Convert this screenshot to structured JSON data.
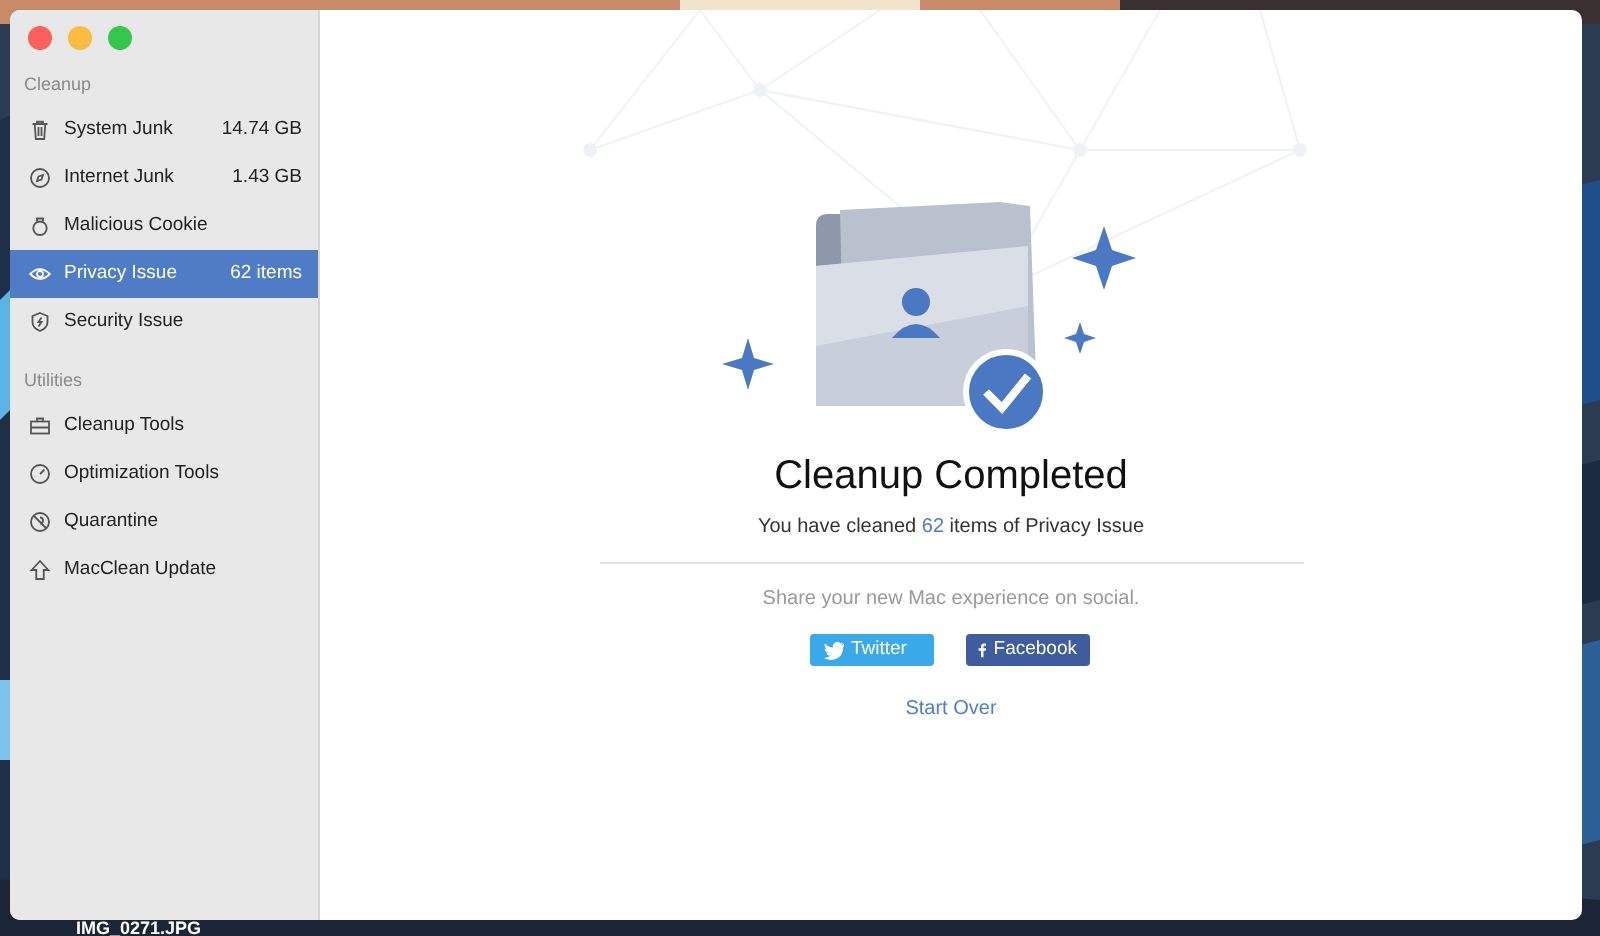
{
  "desktop": {
    "labels": [
      {
        "text": "IMG_0271.JPG"
      }
    ]
  },
  "sidebar": {
    "sections": [
      {
        "heading": "Cleanup",
        "items": [
          {
            "label": "System Junk",
            "value": "14.74 GB",
            "selected": false
          },
          {
            "label": "Internet Junk",
            "value": "1.43 GB",
            "selected": false
          },
          {
            "label": "Malicious Cookie",
            "selected": false
          },
          {
            "label": "Privacy Issue",
            "value": "62 items",
            "selected": true
          },
          {
            "label": "Security Issue",
            "selected": false
          }
        ]
      },
      {
        "heading": "Utilities",
        "items": [
          {
            "label": "Cleanup Tools",
            "selected": false
          },
          {
            "label": "Optimization Tools",
            "selected": false
          },
          {
            "label": "Quarantine",
            "selected": false
          },
          {
            "label": "MacClean Update",
            "selected": false
          }
        ]
      }
    ]
  },
  "main": {
    "title": "Cleanup Completed",
    "summary": "You have cleaned **62** items of Privacy Issue",
    "share_text": "Share your new Mac experience on social.",
    "share_buttons": [
      {
        "label": "Twitter",
        "kind": "twitter"
      },
      {
        "label": "Facebook",
        "kind": "facebook"
      }
    ],
    "link": "Start Over"
  }
}
